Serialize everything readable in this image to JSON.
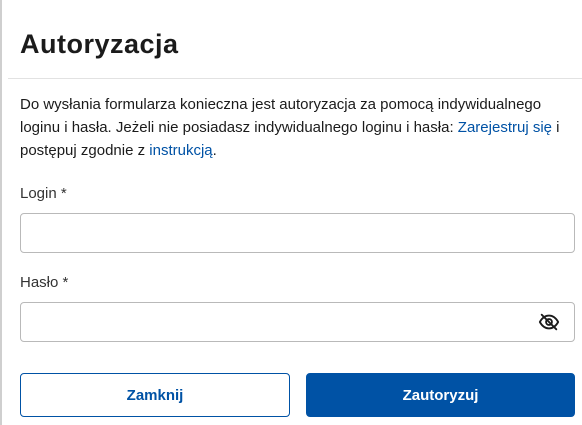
{
  "dialog": {
    "title": "Autoryzacja",
    "intro": {
      "text_before": "Do wysłania formularza konieczna jest autoryzacja za pomocą indywidualnego loginu i hasła. Jeżeli nie posiadasz indywidualnego loginu i hasła: ",
      "register_link": "Zarejestruj się",
      "text_middle": " i postępuj zgodnie z ",
      "instruction_link": "instrukcją",
      "text_after": "."
    },
    "login": {
      "label": "Login *",
      "value": "",
      "placeholder": ""
    },
    "password": {
      "label": "Hasło *",
      "value": "",
      "placeholder": "",
      "toggle_icon": "eye-off-icon"
    },
    "buttons": {
      "close": "Zamknij",
      "authorize": "Zautoryzuj"
    }
  },
  "colors": {
    "accent": "#0052a5",
    "text": "#1b1b1b",
    "border": "#b9b9b9"
  }
}
